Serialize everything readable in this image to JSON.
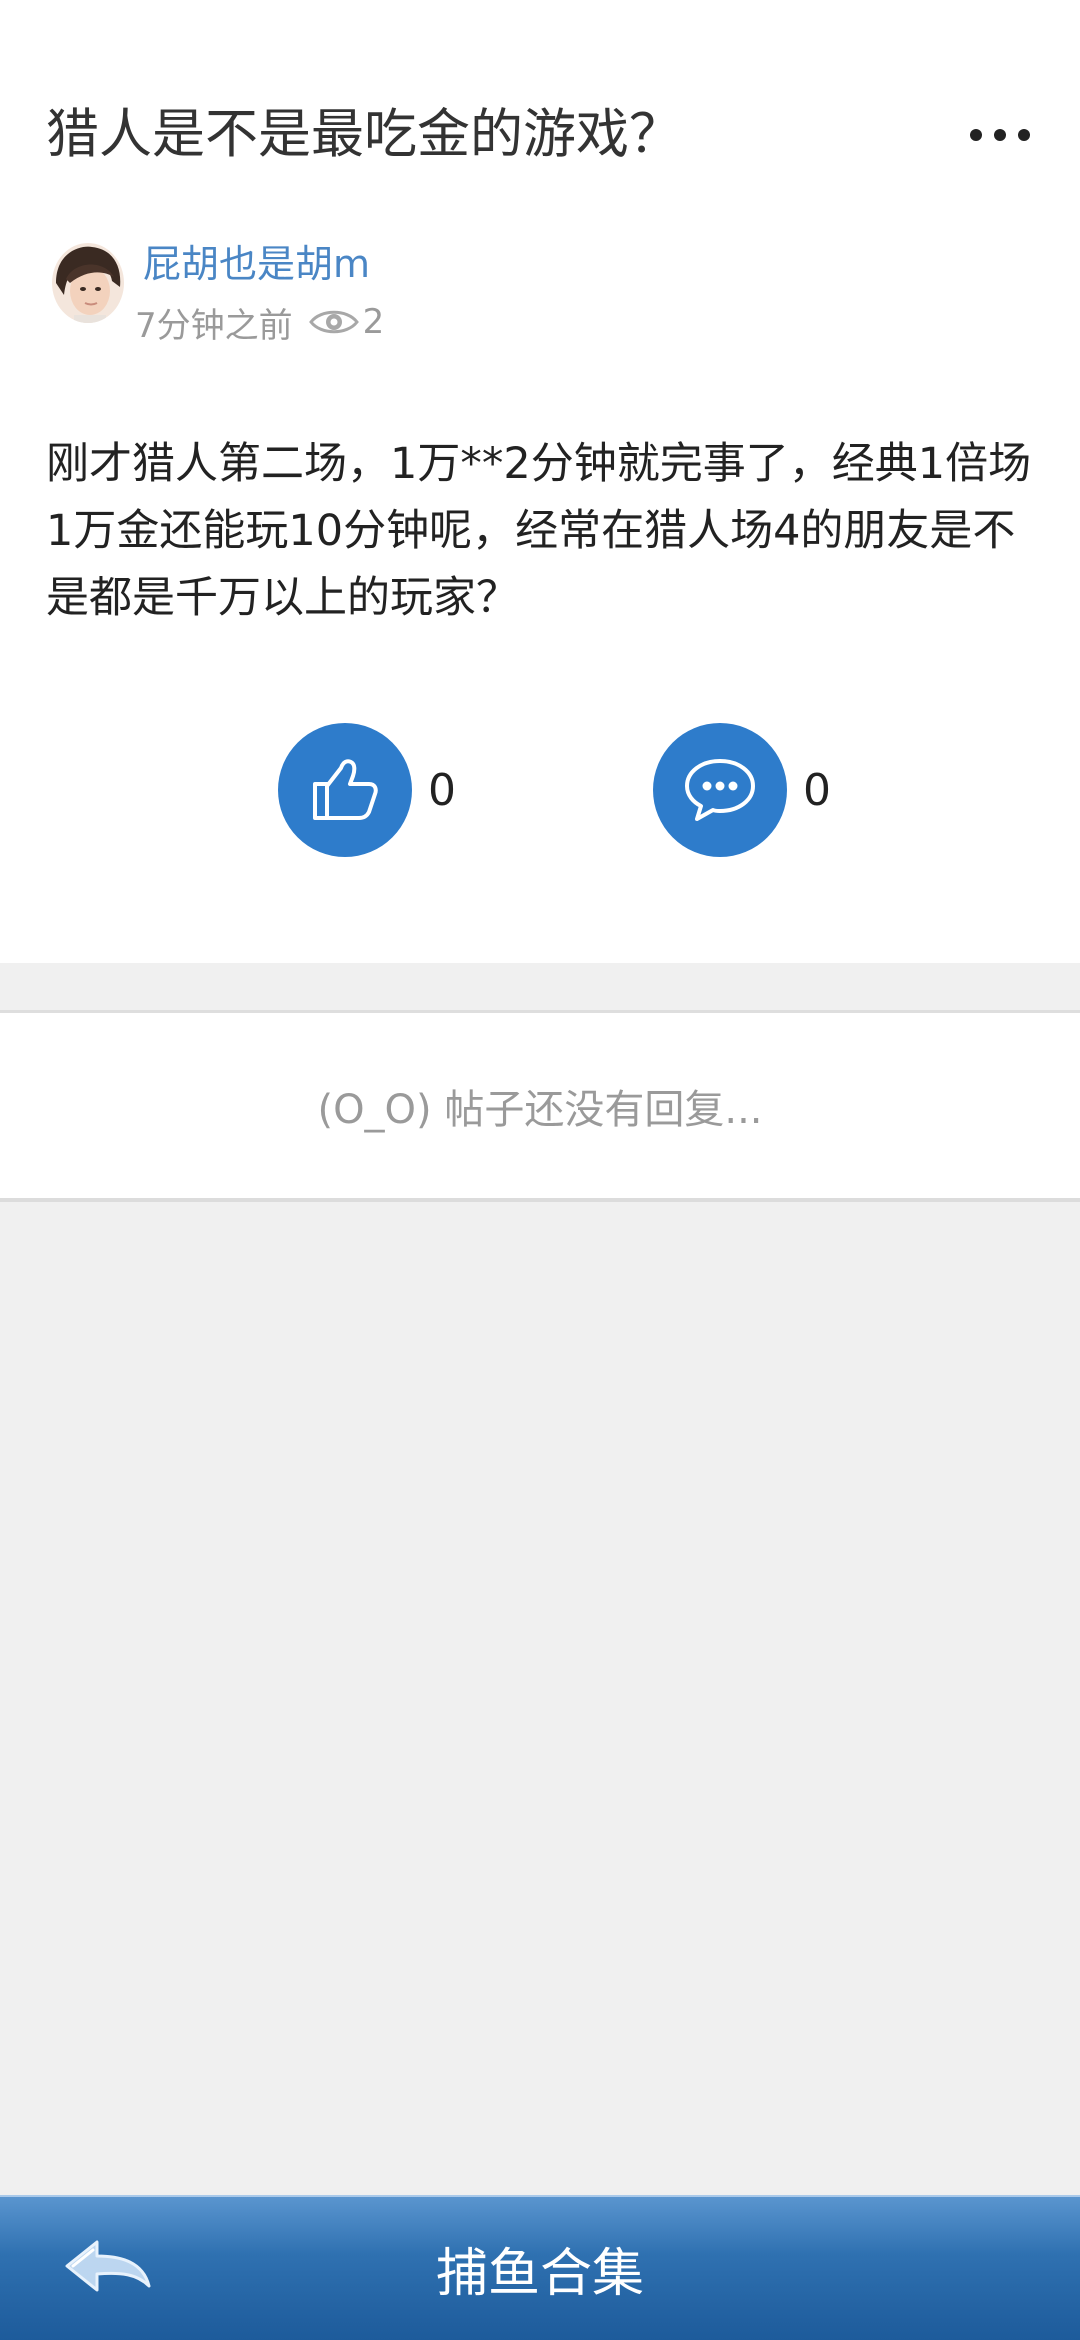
{
  "post": {
    "title": "猎人是不是最吃金的游戏？",
    "author": "屁胡也是胡m",
    "time": "7分钟之前",
    "views": "2",
    "body": "刚才猎人第二场，1万**2分钟就完事了，经典1倍场1万金还能玩10分钟呢，经常在猎人场4的朋友是不是都是千万以上的玩家？",
    "likes": "0",
    "comments": "0"
  },
  "replies": {
    "empty_text": "(O_O) 帖子还没有回复..."
  },
  "bottom_bar": {
    "title": "捕鱼合集"
  },
  "icons": {
    "more": "more-dots-icon",
    "avatar": "user-avatar",
    "views": "eye-icon",
    "like": "thumbs-up-icon",
    "comment": "chat-bubble-icon",
    "back": "back-arrow-icon"
  },
  "colors": {
    "accent": "#2e7ccb",
    "author": "#4a86c5",
    "bar": "#2f71b1"
  }
}
